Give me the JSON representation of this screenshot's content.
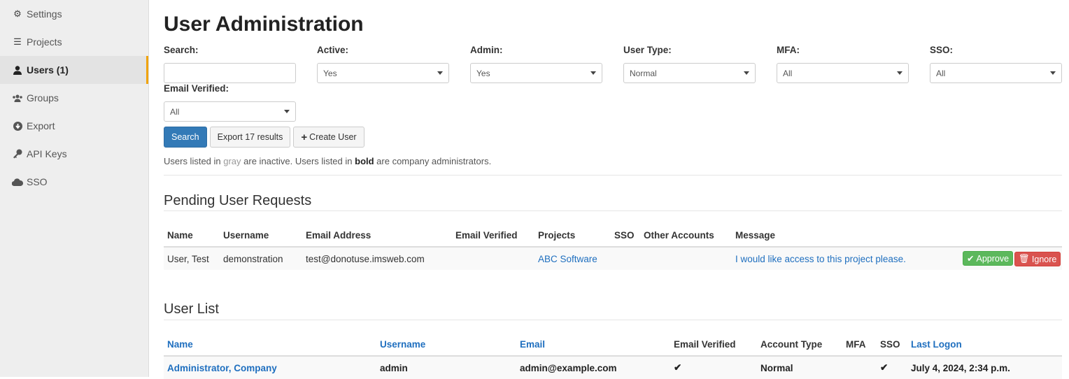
{
  "sidebar": {
    "items": [
      {
        "label": "Settings",
        "icon": "gears-icon"
      },
      {
        "label": "Projects",
        "icon": "list-icon"
      },
      {
        "label": "Users (1)",
        "icon": "user-icon",
        "active": true
      },
      {
        "label": "Groups",
        "icon": "users-icon"
      },
      {
        "label": "Export",
        "icon": "download-icon"
      },
      {
        "label": "API Keys",
        "icon": "key-icon"
      },
      {
        "label": "SSO",
        "icon": "cloud-icon"
      }
    ]
  },
  "page": {
    "title": "User Administration"
  },
  "filters": {
    "search": {
      "label": "Search:",
      "value": ""
    },
    "active": {
      "label": "Active:",
      "value": "Yes"
    },
    "admin": {
      "label": "Admin:",
      "value": "Yes"
    },
    "user_type": {
      "label": "User Type:",
      "value": "Normal"
    },
    "mfa": {
      "label": "MFA:",
      "value": "All"
    },
    "sso": {
      "label": "SSO:",
      "value": "All"
    },
    "email_verified": {
      "label": "Email Verified:",
      "value": "All"
    }
  },
  "buttons": {
    "search": "Search",
    "export": "Export 17 results",
    "create": "Create User"
  },
  "note": {
    "part1": "Users listed in ",
    "gray": "gray",
    "part2": " are inactive. Users listed in ",
    "bold": "bold",
    "part3": " are company administrators."
  },
  "pending": {
    "title": "Pending User Requests",
    "columns": [
      "Name",
      "Username",
      "Email Address",
      "Email Verified",
      "Projects",
      "SSO",
      "Other Accounts",
      "Message"
    ],
    "rows": [
      {
        "name": "User, Test",
        "username": "demonstration",
        "email": "test@donotuse.imsweb.com",
        "email_verified": "",
        "projects": "ABC Software",
        "sso": "",
        "other_accounts": "",
        "message": "I would like access to this project please.",
        "approve": "Approve",
        "ignore": "Ignore"
      }
    ]
  },
  "user_list": {
    "title": "User List",
    "columns": [
      "Name",
      "Username",
      "Email",
      "Email Verified",
      "Account Type",
      "MFA",
      "SSO",
      "Last Logon"
    ],
    "rows": [
      {
        "name": "Administrator, Company",
        "username": "admin",
        "email": "admin@example.com",
        "email_verified": true,
        "account_type": "Normal",
        "mfa": false,
        "sso": true,
        "last_logon": "July 4, 2024, 2:34 p.m."
      }
    ]
  },
  "colors": {
    "accent": "#337ab7",
    "active_marker": "#f0a30a",
    "approve": "#5cb85c",
    "ignore": "#d9534f",
    "link": "#1f6fbf"
  }
}
